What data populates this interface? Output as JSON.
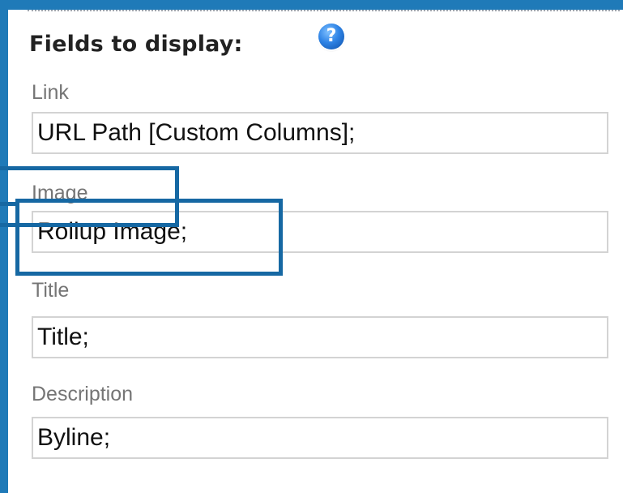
{
  "fields_panel": {
    "heading": "Fields to display:",
    "help_icon": "help-icon",
    "help_glyph": "?",
    "fields": [
      {
        "label": "Link",
        "value": "URL Path [Custom Columns];"
      },
      {
        "label": "Image",
        "value": "Rollup Image;"
      },
      {
        "label": "Title",
        "value": "Title;"
      },
      {
        "label": "Description",
        "value": "Byline;"
      }
    ]
  },
  "colors": {
    "background_frame": "#1f7ab8",
    "highlight": "#1668a3",
    "label_text": "#757575",
    "input_border": "#d3d3d3"
  }
}
